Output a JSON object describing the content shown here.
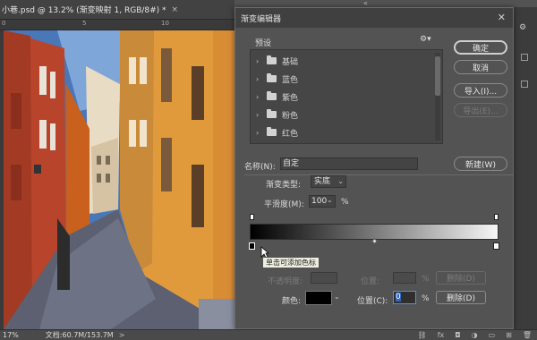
{
  "document": {
    "tab_label": "小巷.psd @ 13.2% (渐变映射 1, RGB/8#) *",
    "close": "×",
    "ruler_labels": [
      "0",
      "5",
      "10"
    ]
  },
  "dialog": {
    "title": "渐变编辑器",
    "presets_label": "预设",
    "presets": [
      {
        "label": "基础"
      },
      {
        "label": "蓝色"
      },
      {
        "label": "紫色"
      },
      {
        "label": "粉色"
      },
      {
        "label": "红色"
      }
    ],
    "buttons": {
      "ok": "确定",
      "cancel": "取消",
      "import": "导入(I)...",
      "export": "导出(E)...",
      "new": "新建(W)"
    },
    "name_label": "名称(N):",
    "name_value": "自定",
    "type_label": "渐变类型:",
    "type_value": "实底",
    "smoothness_label": "平滑度(M):",
    "smoothness_value": "100",
    "percent": "%",
    "tooltip": "单击可添加色标",
    "stops": {
      "opacity_label": "不透明度:",
      "opacity_position_label": "位置:",
      "opacity_delete": "删除(D)",
      "color_label": "颜色:",
      "position_label": "位置(C):",
      "position_value": "0",
      "delete_label": "删除(D)"
    }
  },
  "status": {
    "zoom": "17%",
    "doc_info": "文档:60.7M/153.7M",
    "arrow": ">"
  },
  "colors": {
    "gradient_start": "#000000",
    "gradient_end": "#f6f6f6",
    "color_stop": "#000000"
  }
}
